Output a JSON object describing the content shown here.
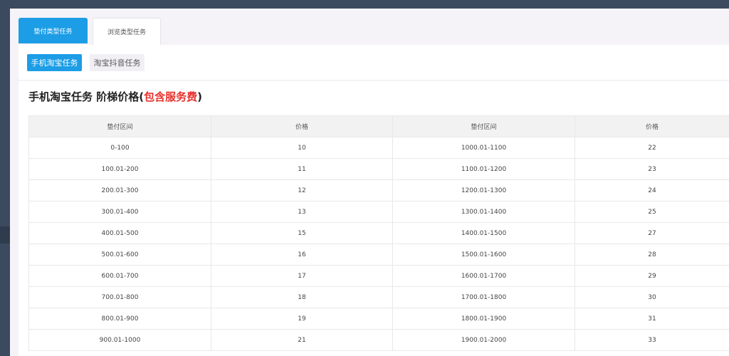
{
  "tabs": [
    {
      "label": "垫付类型任务",
      "active": true
    },
    {
      "label": "浏览类型任务",
      "active": false
    }
  ],
  "subtabs": [
    {
      "label": "手机淘宝任务",
      "active": true
    },
    {
      "label": "淘宝抖音任务",
      "active": false
    }
  ],
  "heading": {
    "main": "手机淘宝任务 阶梯价格(",
    "highlight": "包含服务费",
    "close": ")"
  },
  "table": {
    "headers": [
      "垫付区间",
      "价格",
      "垫付区间",
      "价格"
    ],
    "rows": [
      [
        "0-100",
        "10",
        "1000.01-1100",
        "22"
      ],
      [
        "100.01-200",
        "11",
        "1100.01-1200",
        "23"
      ],
      [
        "200.01-300",
        "12",
        "1200.01-1300",
        "24"
      ],
      [
        "300.01-400",
        "13",
        "1300.01-1400",
        "25"
      ],
      [
        "400.01-500",
        "15",
        "1400.01-1500",
        "27"
      ],
      [
        "500.01-600",
        "16",
        "1500.01-1600",
        "28"
      ],
      [
        "600.01-700",
        "17",
        "1600.01-1700",
        "29"
      ],
      [
        "700.01-800",
        "18",
        "1700.01-1800",
        "30"
      ],
      [
        "800.01-900",
        "19",
        "1800.01-1900",
        "31"
      ],
      [
        "900.01-1000",
        "21",
        "1900.01-2000",
        "33"
      ]
    ]
  },
  "colors": {
    "accent": "#1c9de6",
    "highlight": "#e8302b",
    "frame": "#3b4a5e"
  }
}
